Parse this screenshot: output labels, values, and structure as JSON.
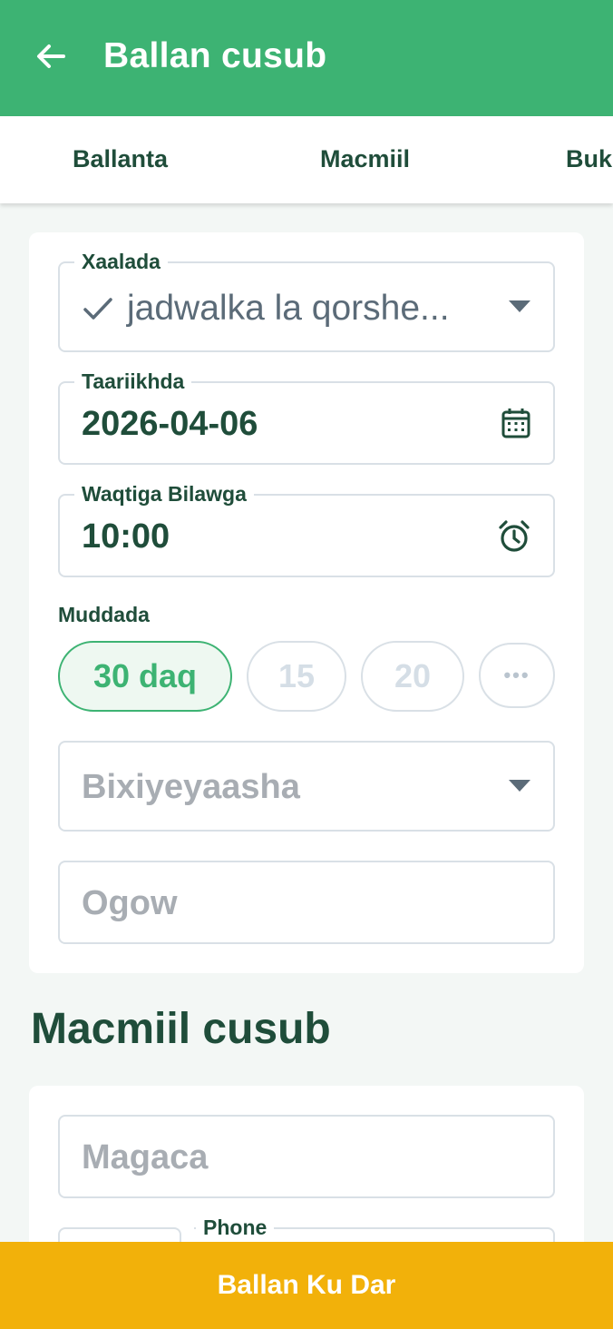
{
  "appbar": {
    "title": "Ballan cusub",
    "back_icon": "arrow-left-icon"
  },
  "tabs": [
    {
      "label": "Ballanta"
    },
    {
      "label": "Macmiil"
    },
    {
      "label": "Buk"
    }
  ],
  "appointment": {
    "status": {
      "label": "Xaalada",
      "value": "jadwalka la qorshe...",
      "icon": "check-icon"
    },
    "date": {
      "label": "Taariikhda",
      "value": "2026-04-06",
      "icon": "calendar-icon"
    },
    "start_time": {
      "label": "Waqtiga Bilawga",
      "value": "10:00",
      "icon": "alarm-clock-icon"
    },
    "duration": {
      "label": "Muddada",
      "options": [
        {
          "label": "30 daq",
          "selected": true
        },
        {
          "label": "15",
          "selected": false
        },
        {
          "label": "20",
          "selected": false
        },
        {
          "label": "•••",
          "selected": false
        }
      ]
    },
    "providers": {
      "placeholder": "Bixiyeyaasha"
    },
    "notes": {
      "placeholder": "Ogow"
    }
  },
  "new_client": {
    "title": "Macmiil cusub",
    "name": {
      "placeholder": "Magaca"
    },
    "phone": {
      "label": "Phone"
    }
  },
  "submit": {
    "label": "Ballan Ku Dar"
  },
  "colors": {
    "primary": "#3db373",
    "accent": "#f2b10a",
    "text": "#1f4d3a"
  }
}
